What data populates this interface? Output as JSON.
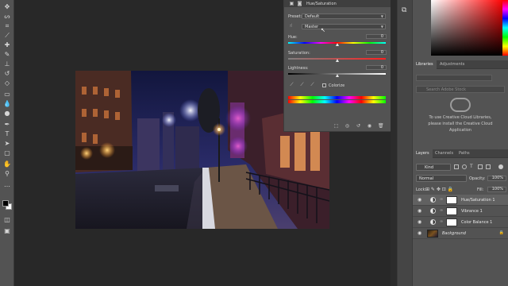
{
  "toolbar": {
    "tools": [
      {
        "name": "move-tool",
        "glyph": "✥"
      },
      {
        "name": "lasso-tool",
        "glyph": "ᔕ"
      },
      {
        "name": "crop-tool",
        "glyph": "⌗"
      },
      {
        "name": "eyedropper-tool",
        "glyph": "⟋"
      },
      {
        "name": "healing-brush-tool",
        "glyph": "✚"
      },
      {
        "name": "brush-tool",
        "glyph": "✎"
      },
      {
        "name": "clone-stamp-tool",
        "glyph": "⊥"
      },
      {
        "name": "history-brush-tool",
        "glyph": "↺"
      },
      {
        "name": "eraser-tool",
        "glyph": "◇"
      },
      {
        "name": "gradient-tool",
        "glyph": "▭"
      },
      {
        "name": "blur-tool",
        "glyph": "💧"
      },
      {
        "name": "dodge-tool",
        "glyph": "●"
      },
      {
        "name": "pen-tool",
        "glyph": "✒"
      },
      {
        "name": "type-tool",
        "glyph": "T"
      },
      {
        "name": "path-selection-tool",
        "glyph": "➤"
      },
      {
        "name": "rectangle-tool",
        "glyph": "▢"
      },
      {
        "name": "hand-tool",
        "glyph": "✋"
      },
      {
        "name": "zoom-tool",
        "glyph": "⚲"
      },
      {
        "name": "more-tools",
        "glyph": "…"
      }
    ],
    "foreground_color": "#000000",
    "background_color": "#ffffff"
  },
  "properties": {
    "title": "Hue/Saturation",
    "preset_label": "Preset:",
    "preset_value": "Default",
    "channel_value": "Master",
    "hue_label": "Hue:",
    "hue_value": "0",
    "hue_level": 0.5,
    "saturation_label": "Saturation:",
    "saturation_value": "0",
    "saturation_level": 0.5,
    "lightness_label": "Lightness:",
    "lightness_value": "0",
    "lightness_level": 0.5,
    "colorize_label": "Colorize"
  },
  "libraries": {
    "tabs": [
      "Libraries",
      "Adjustments"
    ],
    "search_placeholder": "Search Adobe Stock",
    "message": [
      "To use Creative Cloud Libraries,",
      "please install the Creative Cloud",
      "Application"
    ]
  },
  "layers": {
    "tabs": [
      "Layers",
      "Channels",
      "Paths"
    ],
    "filter": "Kind",
    "blend_mode": "Normal",
    "opacity_label": "Opacity:",
    "opacity_value": "100%",
    "lock_label": "Lock:",
    "fill_label": "Fill:",
    "fill_value": "100%",
    "items": [
      {
        "name": "Hue/Saturation 1",
        "type": "adjustment",
        "selected": true
      },
      {
        "name": "Vibrance 1",
        "type": "adjustment",
        "selected": false
      },
      {
        "name": "Color Balance 1",
        "type": "adjustment",
        "selected": false
      },
      {
        "name": "Background",
        "type": "pixel",
        "selected": false
      }
    ]
  },
  "colors": {
    "ui_panel": "#535353",
    "workspace": "#282828",
    "selected_row": "#616161"
  }
}
